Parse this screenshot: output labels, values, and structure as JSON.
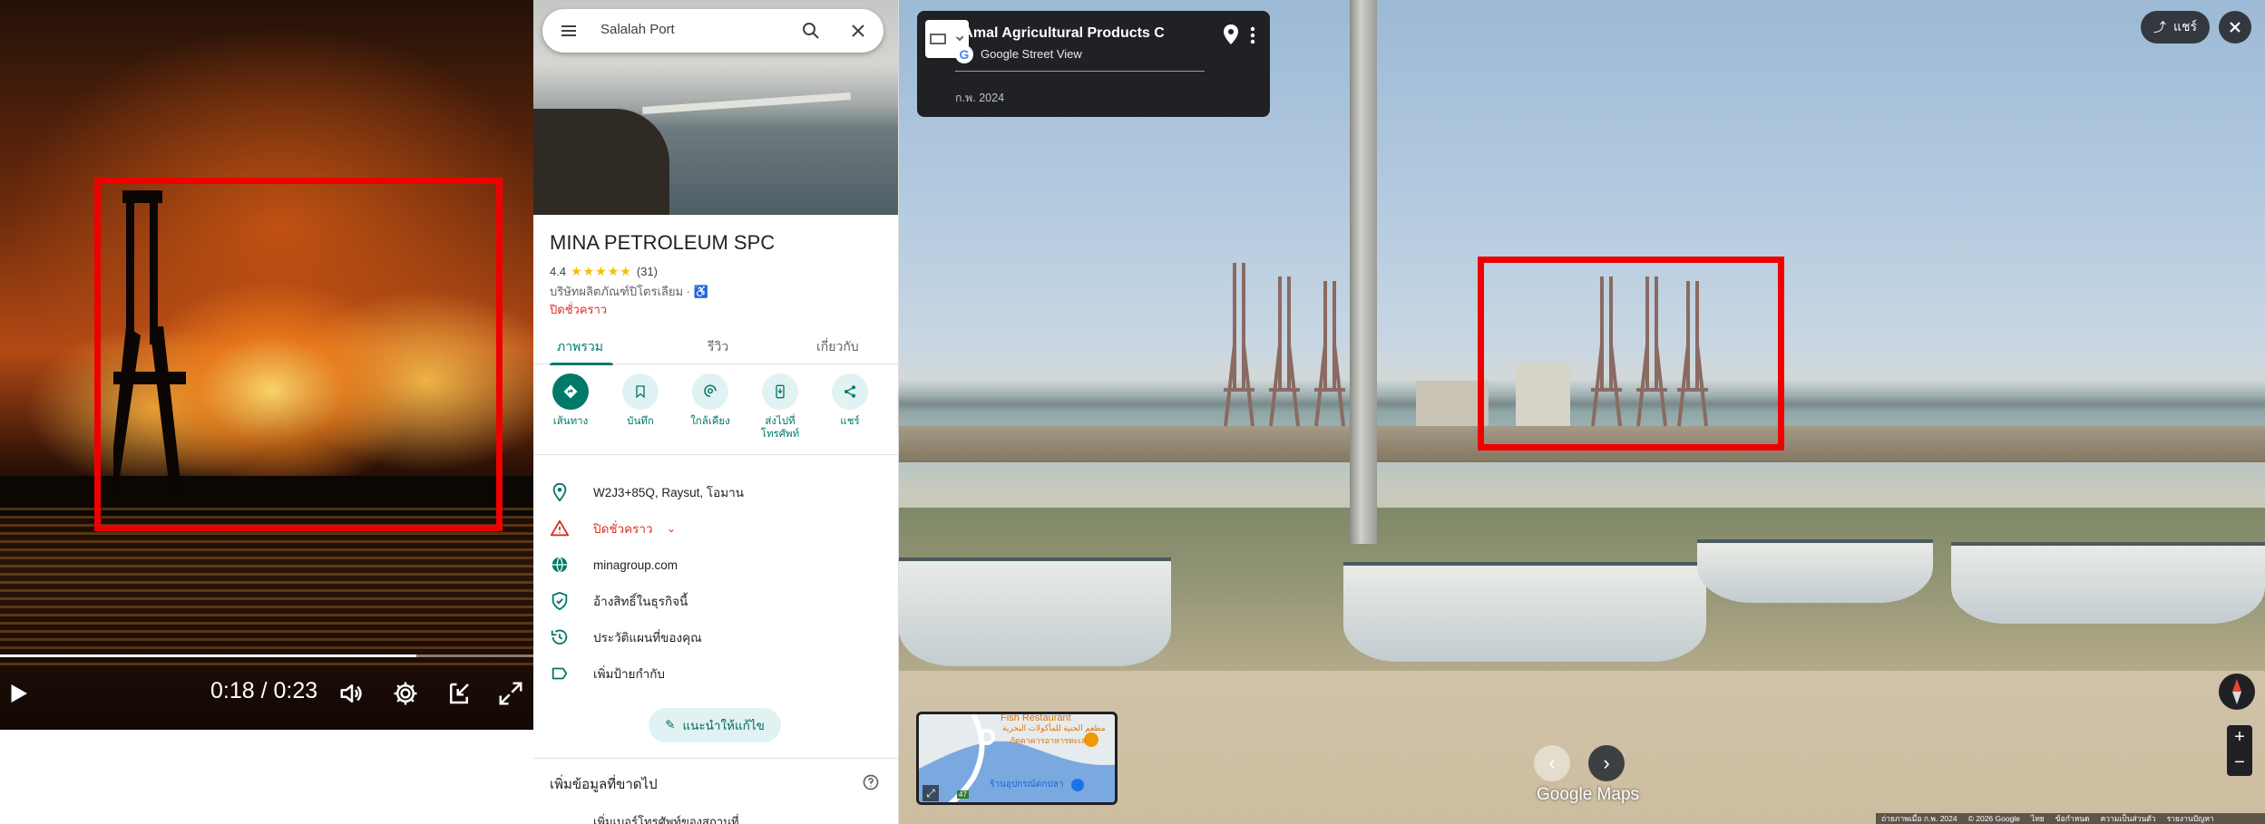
{
  "video": {
    "time_display": "0:18 / 0:23",
    "progress_fraction": 0.78
  },
  "sidebar": {
    "search": {
      "query": "Salalah Port"
    },
    "place": {
      "title": "MINA PETROLEUM SPC",
      "rating": "4.4",
      "stars": "★★★★★",
      "review_count": "(31)",
      "category": "บริษัทผลิตภัณฑ์ปิโตรเลียม ·",
      "status": "ปิดชั่วคราว"
    },
    "tabs": [
      {
        "label": "ภาพรวม"
      },
      {
        "label": "รีวิว"
      },
      {
        "label": "เกี่ยวกับ"
      }
    ],
    "actions": [
      {
        "label": "เส้นทาง",
        "icon": "directions-icon"
      },
      {
        "label": "บันทึก",
        "icon": "bookmark-icon"
      },
      {
        "label": "ใกล้เคียง",
        "icon": "nearby-icon"
      },
      {
        "label": "ส่งไปที่โทรศัพท์",
        "icon": "send-to-phone-icon"
      },
      {
        "label": "แชร์",
        "icon": "share-icon"
      }
    ],
    "info": {
      "address": "W2J3+85Q, Raysut, โอมาน",
      "status": "ปิดชั่วคราว",
      "website": "minagroup.com",
      "claim": "อ้างสิทธิ์ในธุรกิจนี้",
      "history": "ประวัติแผนที่ของคุณ",
      "label": "เพิ่มป้ายกำกับ"
    },
    "suggest_edit": "แนะนำให้แก้ไข",
    "missing_info": "เพิ่มข้อมูลที่ขาดไป",
    "cut_row": "เพิ่มเบอร์โทรศัพท์ของสถานที่"
  },
  "streetview": {
    "card_title": "l Amal Agricultural Products Comp...",
    "card_source": "Google Street View",
    "card_date": "ก.พ. 2024",
    "share_label": "แชร์",
    "minimap": {
      "label_top": "Fish Restaurant",
      "label_arabic": "مطعم الحنية للمأكولات البحرية",
      "label_thai": "ภัตตาคารอาหารทะเล",
      "label_bottom": "ร้านอุปกรณ์ตกปลา",
      "road_number": "47"
    },
    "logo": "Google Maps",
    "footer": [
      "ถ่ายภาพเมื่อ ก.พ. 2024",
      "© 2026 Google",
      "ไทย",
      "ข้อกำหนด",
      "ความเป็นส่วนตัว",
      "รายงานปัญหา"
    ]
  },
  "colors": {
    "accent": "#00796b",
    "closed": "#d93025",
    "highlight_box": "#ee0000",
    "dark_ui": "#202124"
  }
}
